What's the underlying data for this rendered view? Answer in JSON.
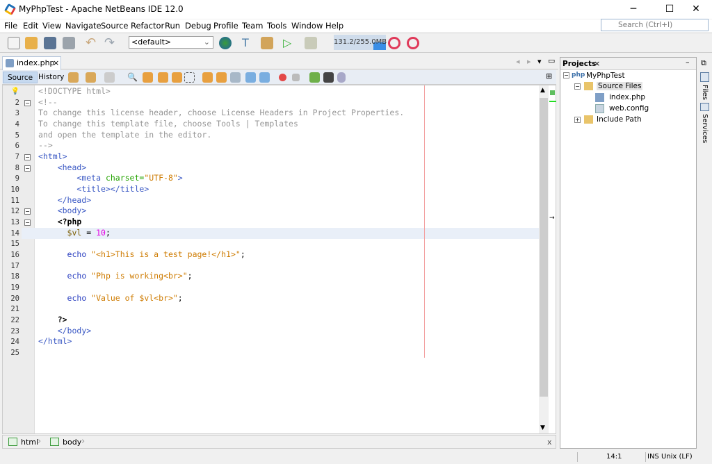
{
  "window": {
    "title": "MyPhpTest - Apache NetBeans IDE 12.0",
    "minimize": "─",
    "maximize": "☐",
    "close": "✕"
  },
  "menu": [
    "File",
    "Edit",
    "View",
    "Navigate",
    "Source",
    "Refactor",
    "Run",
    "Debug",
    "Profile",
    "Team",
    "Tools",
    "Window",
    "Help"
  ],
  "search": {
    "placeholder": "Search (Ctrl+I)"
  },
  "toolbar": {
    "config": "<default>",
    "memory": "131.2/255.0MB",
    "memory_used_fraction": 0.51
  },
  "editor_tab": {
    "label": "index.php",
    "close": "×"
  },
  "editor_toolbar": {
    "source": "Source",
    "history": "History"
  },
  "code_lines": [
    [
      [
        "<!DOCTYPE html>",
        "cm"
      ]
    ],
    [
      [
        "<!--",
        "cm"
      ]
    ],
    [
      [
        "To change this license header, choose License Headers in Project Properties.",
        "cm"
      ]
    ],
    [
      [
        "To change this template file, choose Tools | Templates",
        "cm"
      ]
    ],
    [
      [
        "and open the template in the editor.",
        "cm"
      ]
    ],
    [
      [
        "-->",
        "cm"
      ]
    ],
    [
      [
        "<html>",
        "tg"
      ]
    ],
    [
      [
        "    ",
        "tx"
      ],
      [
        "<head>",
        "tg"
      ]
    ],
    [
      [
        "        ",
        "tx"
      ],
      [
        "<meta ",
        "tg"
      ],
      [
        "charset=",
        "at"
      ],
      [
        "\"UTF-8\"",
        "st"
      ],
      [
        ">",
        "tg"
      ]
    ],
    [
      [
        "        ",
        "tx"
      ],
      [
        "<title></title>",
        "tg"
      ]
    ],
    [
      [
        "    ",
        "tx"
      ],
      [
        "</head>",
        "tg"
      ]
    ],
    [
      [
        "    ",
        "tx"
      ],
      [
        "<body>",
        "tg"
      ]
    ],
    [
      [
        "    ",
        "tx"
      ],
      [
        "<?php",
        "ph"
      ]
    ],
    [
      [
        "      ",
        "tx"
      ],
      [
        "$vl",
        "vr"
      ],
      [
        " = ",
        "tx"
      ],
      [
        "10",
        "nm"
      ],
      [
        ";",
        "tx"
      ]
    ],
    [
      [
        "",
        "tx"
      ]
    ],
    [
      [
        "      ",
        "tx"
      ],
      [
        "echo ",
        "kw"
      ],
      [
        "\"<h1>This is a test page!</h1>\"",
        "st"
      ],
      [
        ";",
        "tx"
      ]
    ],
    [
      [
        "",
        "tx"
      ]
    ],
    [
      [
        "      ",
        "tx"
      ],
      [
        "echo ",
        "kw"
      ],
      [
        "\"Php is working<br>\"",
        "st"
      ],
      [
        ";",
        "tx"
      ]
    ],
    [
      [
        "",
        "tx"
      ]
    ],
    [
      [
        "      ",
        "tx"
      ],
      [
        "echo ",
        "kw"
      ],
      [
        "\"Value of $vl<br>\"",
        "st"
      ],
      [
        ";",
        "tx"
      ]
    ],
    [
      [
        "",
        "tx"
      ]
    ],
    [
      [
        "    ",
        "tx"
      ],
      [
        "?>",
        "ph"
      ]
    ],
    [
      [
        "    ",
        "tx"
      ],
      [
        "</body>",
        "tg"
      ]
    ],
    [
      [
        "</html>",
        "tg"
      ]
    ],
    [
      [
        "",
        "tx"
      ]
    ]
  ],
  "breadcrumb": [
    "html",
    "body"
  ],
  "breadcrumb_close": "x",
  "status": {
    "position": "14:1",
    "mode": "INS",
    "line_endings": "Unix (LF)"
  },
  "projects": {
    "title": "Projects",
    "close": "×",
    "tree": [
      {
        "label": "MyPhpTest",
        "icon": "php-project-icon"
      },
      {
        "label": "Source Files",
        "icon": "folder-icon"
      },
      {
        "label": "index.php",
        "icon": "php-file-icon"
      },
      {
        "label": "web.config",
        "icon": "config-file-icon"
      },
      {
        "label": "Include Path",
        "icon": "folder-icon"
      }
    ]
  },
  "side_tabs": [
    "Files",
    "Services"
  ]
}
